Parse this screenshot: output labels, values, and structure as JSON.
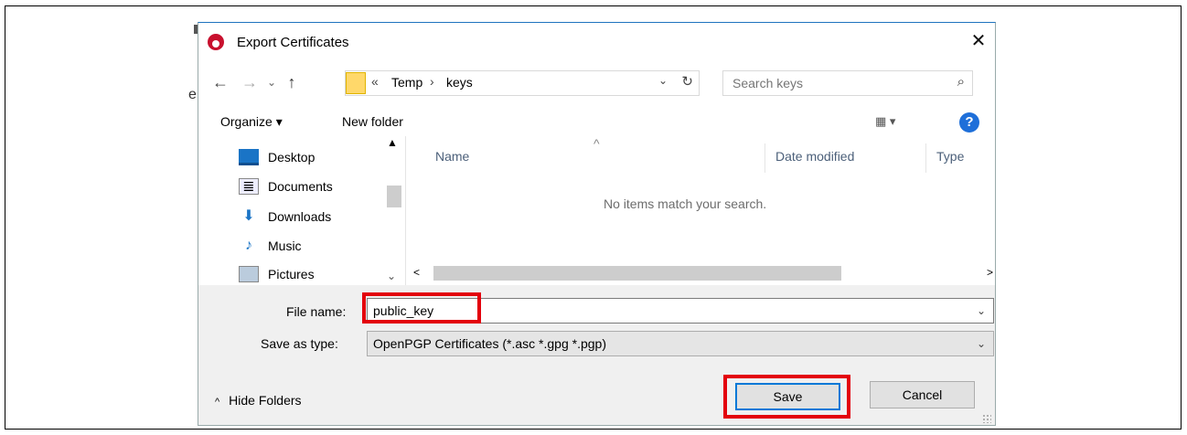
{
  "window": {
    "title": "Export Certificates",
    "close_glyph": "✕"
  },
  "background": {
    "fragment_text": "e"
  },
  "address_bar": {
    "back_glyph": "←",
    "forward_glyph": "→",
    "recent_glyph": "⌄",
    "up_glyph": "↑",
    "overflow_glyph": "«",
    "breadcrumb": [
      "Temp",
      "keys"
    ],
    "separator_glyph": "›",
    "dropdown_glyph": "⌄",
    "refresh_glyph": "↻"
  },
  "search": {
    "placeholder": "Search keys",
    "icon_glyph": "⌕"
  },
  "toolbar": {
    "organize_label": "Organize ▾",
    "new_folder_label": "New folder",
    "view_label": "▦ ▾",
    "help_glyph": "?"
  },
  "nav_pane": {
    "items": [
      {
        "label": "Desktop",
        "icon": "desktop-icon"
      },
      {
        "label": "Documents",
        "icon": "documents-icon"
      },
      {
        "label": "Downloads",
        "icon": "downloads-icon"
      },
      {
        "label": "Music",
        "icon": "music-icon"
      },
      {
        "label": "Pictures",
        "icon": "pictures-icon"
      }
    ],
    "glyphs": {
      "scroll_up": "▲",
      "scroll_down": "⌄",
      "downloads": "⬇",
      "music": "♪",
      "documents": "≣"
    }
  },
  "file_list": {
    "columns": [
      "Name",
      "Date modified",
      "Type"
    ],
    "sort_glyph": "^",
    "empty_message": "No items match your search.",
    "scroll_left": "<",
    "scroll_right": ">"
  },
  "form": {
    "file_name_label": "File name:",
    "file_name_value": "public_key",
    "save_as_type_label": "Save as type:",
    "save_as_type_value": "OpenPGP Certificates (*.asc *.gpg *.pgp)",
    "dropdown_glyph": "⌄",
    "hide_folders_label": "Hide Folders",
    "hide_folders_glyph": "^",
    "save_label": "Save",
    "cancel_label": "Cancel"
  },
  "colors": {
    "highlight": "#e3000b",
    "accent": "#0078d7",
    "app_icon": "#c8102e"
  }
}
